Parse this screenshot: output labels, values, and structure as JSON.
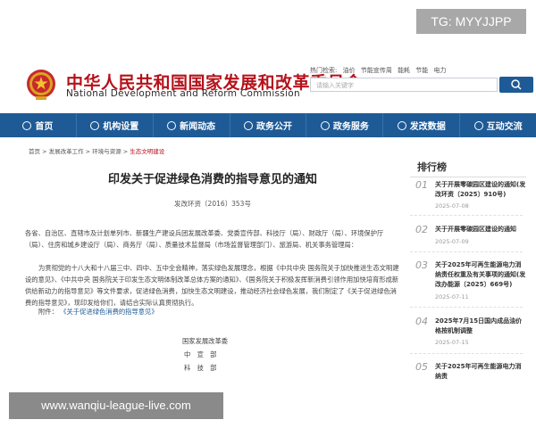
{
  "watermarks": {
    "tg": "TG: MYYJJPP",
    "url": "www.wanqiu-league-live.com"
  },
  "header": {
    "title_cn": "中华人民共和国国家发展和改革委员会",
    "title_en": "National Development and Reform Commission",
    "hotwords": [
      "热门检索:",
      "油价",
      "节能宣传周",
      "能耗",
      "节能",
      "电力"
    ],
    "search_placeholder": "请输入关键字"
  },
  "nav": {
    "items": [
      "首页",
      "机构设置",
      "新闻动态",
      "政务公开",
      "政务服务",
      "发改数据",
      "互动交流"
    ]
  },
  "breadcrumb": {
    "items": [
      "首页",
      "发展改革工作",
      "环境与资源"
    ],
    "current": "生态文明建设",
    "sep": " > "
  },
  "article": {
    "title": "印发关于促进绿色消费的指导意见的通知",
    "doc_no": "发改环资〔2016〕353号",
    "p1": "各省、自治区、直辖市及计划单列市、新疆生产建设兵团发展改革委、党委宣传部、科技厅（局）、财政厅（局）、环境保护厅（局）、住房和城乡建设厅（局）、商务厅（局）、质量技术监督局（市场监督管理部门）、旅游局、机关事务管理局：",
    "p2": "为贯彻党的十八大和十八届三中、四中、五中全会精神，落实绿色发展理念，根据《中共中央 国务院关于加快推进生态文明建设的意见》、《中共中央 国务院关于印发生态文明体制改革总体方案的通知》、《国务院关于积极发挥新消费引领作用加快培育形成新供给新动力的指导意见》等文件要求，促进绿色消费，加快生态文明建设，推动经济社会绿色发展，我们制定了《关于促进绿色消费的指导意见》，现印发给你们，请结合实际认真贯彻执行。",
    "attach_label": "附件：",
    "attach_link": "《关于促进绿色消费的指导意见》",
    "sign1": "国家发展改革委",
    "sign2": "中　宣　部",
    "sign3": "科　技　部"
  },
  "sidebar": {
    "title": "排行榜",
    "items": [
      {
        "no": "01",
        "title": "关于开展零碳园区建设的通知(发改环资〔2025〕910号)",
        "date": "2025-07-08"
      },
      {
        "no": "02",
        "title": "关于开展零碳园区建设的通知",
        "date": "2025-07-09"
      },
      {
        "no": "03",
        "title": "关于2025年可再生能源电力消纳责任权重及有关事项的通知(发改办能源〔2025〕669号)",
        "date": "2025-07-11"
      },
      {
        "no": "04",
        "title": "2025年7月15日国内成品油价格按机制调整",
        "date": "2025-07-15"
      },
      {
        "no": "05",
        "title": "关于2025年可再生能源电力消纳责",
        "date": ""
      }
    ]
  },
  "colors": {
    "primary": "#1e5a96",
    "brand_red": "#b5121b"
  }
}
